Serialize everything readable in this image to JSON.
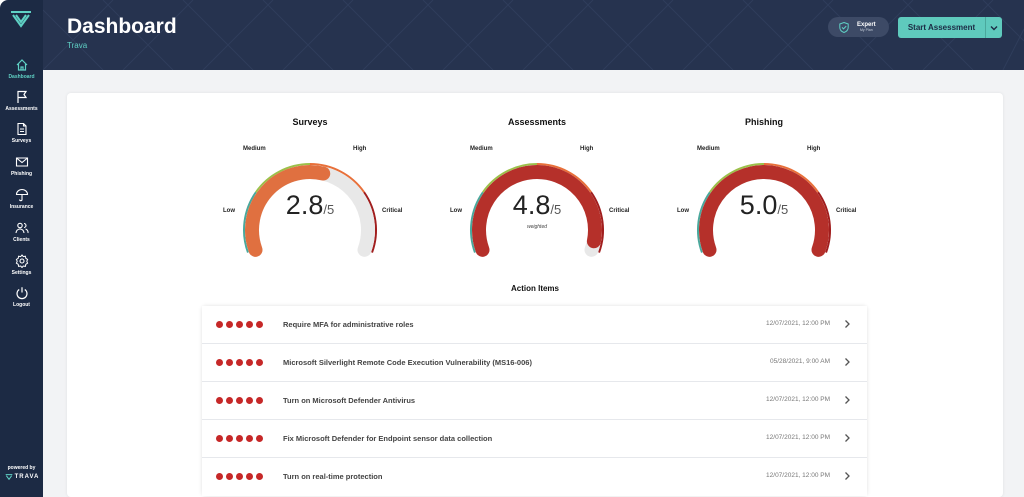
{
  "sidebar": {
    "logo_icon": "trava-logo-icon",
    "items": [
      {
        "label": "Dashboard",
        "icon": "home-icon",
        "active": true
      },
      {
        "label": "Assessments",
        "icon": "flag-icon",
        "active": false
      },
      {
        "label": "Surveys",
        "icon": "document-icon",
        "active": false
      },
      {
        "label": "Phishing",
        "icon": "mail-icon",
        "active": false
      },
      {
        "label": "Insurance",
        "icon": "umbrella-icon",
        "active": false
      },
      {
        "label": "Clients",
        "icon": "users-icon",
        "active": false
      },
      {
        "label": "Settings",
        "icon": "gear-icon",
        "active": false
      },
      {
        "label": "Logout",
        "icon": "power-icon",
        "active": false
      }
    ],
    "powered_by": "powered by",
    "brand": "TRAVA"
  },
  "header": {
    "title": "Dashboard",
    "subtitle": "Trava",
    "plan": {
      "name": "Expert",
      "sub": "My Plan",
      "icon": "shield-check-icon"
    },
    "start_button_label": "Start Assessment",
    "dropdown_icon": "chevron-down-icon"
  },
  "gauges": [
    {
      "title": "Surveys",
      "value": "2.8",
      "max": "/5",
      "note": "",
      "score": 2.8,
      "fill_color": "#e07040"
    },
    {
      "title": "Assessments",
      "value": "4.8",
      "max": "/5",
      "note": "weighted",
      "score": 4.8,
      "fill_color": "#b5302a"
    },
    {
      "title": "Phishing",
      "value": "5.0",
      "max": "/5",
      "note": "",
      "score": 5.0,
      "fill_color": "#b5302a"
    }
  ],
  "gauge_labels": {
    "low": "Low",
    "medium": "Medium",
    "high": "High",
    "critical": "Critical"
  },
  "colors": {
    "sidebar_bg": "#1c2a44",
    "header_bg": "#26334f",
    "accent": "#5fcabd",
    "severity_dot": "#c62828",
    "scale_low": "#4aa89c",
    "scale_medium": "#9cc04a",
    "scale_high": "#e8703a",
    "scale_critical": "#a11e1e"
  },
  "action_items_title": "Action Items",
  "action_items": [
    {
      "title": "Require MFA for administrative roles",
      "date": "12/07/2021, 12:00 PM",
      "severity": 5
    },
    {
      "title": "Microsoft Silverlight Remote Code Execution Vulnerability (MS16-006)",
      "date": "05/28/2021, 9:00 AM",
      "severity": 5
    },
    {
      "title": "Turn on Microsoft Defender Antivirus",
      "date": "12/07/2021, 12:00 PM",
      "severity": 5
    },
    {
      "title": "Fix Microsoft Defender for Endpoint sensor data collection",
      "date": "12/07/2021, 12:00 PM",
      "severity": 5
    },
    {
      "title": "Turn on real-time protection",
      "date": "12/07/2021, 12:00 PM",
      "severity": 5
    }
  ]
}
